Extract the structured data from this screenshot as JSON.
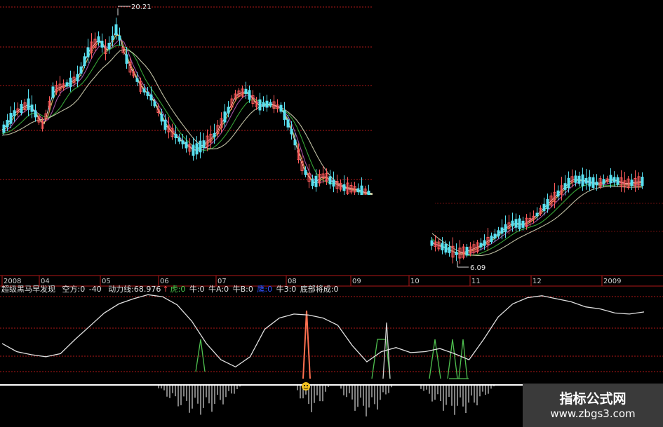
{
  "indicator": {
    "name": "超级黑马早发现",
    "kongfang": "空方:0",
    "kongfang_val": "-40",
    "dongli": "动力线:68.976",
    "arrow": "↑",
    "hu": "虎:0",
    "niu": "牛:0",
    "niu_a": "牛A:0",
    "niu_b": "牛B:0",
    "ying": "鹰:0",
    "niu3": "牛3:0",
    "dibu": "底部将成:0"
  },
  "watermark": {
    "title": "指标公式网",
    "url": "www.zbgs3.com"
  },
  "colors": {
    "up": "#ff5a5a",
    "down": "#58e0f0",
    "ma5": "#ffffff",
    "ma10": "#f0d060",
    "ma20": "#c060c0",
    "ma60": "#40c040",
    "ma120": "#e0e0c0",
    "grid": "#b01818",
    "dongli": "#e0e0e0",
    "signal_green": "#4fc04f",
    "signal_red": "#ff7050",
    "hist": "#ffffff"
  },
  "chart_data": {
    "type": "candlestick",
    "x_ticks": [
      "2008",
      "04",
      "05",
      "06",
      "07",
      "08",
      "09",
      "10",
      "11",
      "12",
      "2009"
    ],
    "high_label": "20.21",
    "low_label": "6.09",
    "high_value": 20.21,
    "low_value": 6.09,
    "indicator_series": {
      "name": "动力线",
      "values": [
        38,
        30,
        27,
        25,
        28,
        42,
        55,
        68,
        77,
        82,
        86,
        84,
        76,
        60,
        38,
        22,
        15,
        25,
        52,
        63,
        67,
        66,
        63,
        56,
        36,
        20,
        30,
        34,
        29,
        30,
        33,
        28,
        22,
        42,
        64,
        77,
        83,
        85,
        82,
        79,
        74,
        72,
        68,
        67,
        69
      ]
    }
  }
}
